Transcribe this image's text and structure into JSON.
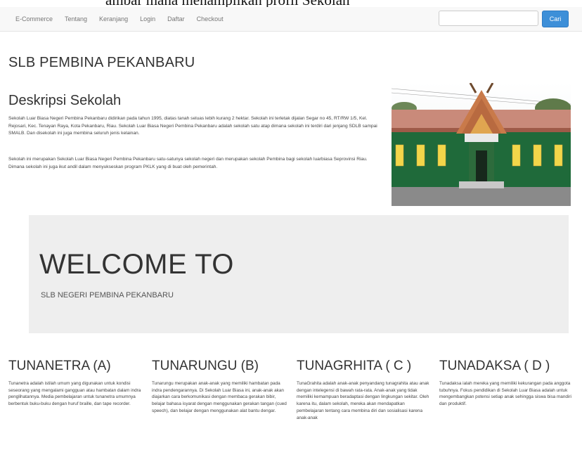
{
  "caption": "ambar mana menampilkan profil Sekolah",
  "navbar": {
    "links": [
      "E-Commerce",
      "Tentang",
      "Keranjang",
      "Login",
      "Daftar",
      "Checkout"
    ],
    "search": {
      "value": "",
      "placeholder": ""
    },
    "search_button": "Cari"
  },
  "school_name": "SLB PEMBINA PEKANBARU",
  "description": {
    "title": "Deskripsi Sekolah",
    "paragraph1": "Sekolah Luar Biasa Negeri Pembina Pekanbaru didirikan pada tahun 1995, diatas tanah seluas lebih kurang 2 hektar. Sekolah ini terletak dijalan Segar no 45, RT/RW 1/5, Kel. Rejosari, Kec. Tenayan Raya, Kota Pekanbaru, Riau. Sekolah Luar Biasa Negeri Pembina Pekanbaru adalah sekolah satu atap dimana sekolah ini terdiri dari jenjang SDLB sampai SMALB. Dan disekolah ini juga membina seluruh jenis kelainan.",
    "paragraph2": "Sekolah ini merupakan Sekolah Luar Biasa Negeri Pembina Pekanbaru satu-satunya sekolah negeri dan merupakan sekolah Pembina bagi sekolah luarbiasa Seprovinsi Riau. Dimana sekolah ini juga ikut andil dalam menyukseskan program PKLK yang di buat oleh pemerintah."
  },
  "jumbotron": {
    "heading": "WELCOME TO",
    "subheading": "SLB NEGERI PEMBINA PEKANBARU"
  },
  "categories": [
    {
      "title": "TUNANETRA (A)",
      "text": "Tunanetra adalah istilah umum yang digunakan untuk kondisi seseorang yang mengalami gangguan atau hambatan dalam indra penglihatannya. Media pembelajaran untuk tunanetra umumnya berbentuk buku-buku dengan huruf braille, dan tape recorder."
    },
    {
      "title": "TUNARUNGU (B)",
      "text": "Tunarungu merupakan anak-anak yang memiliki hambatan pada indra pendengarannya. Di Sekolah Luar Biasa ini, anak-anak akan diajarkan cara berkomunikasi dengan membaca gerakan bibir, belajar bahasa isyarat dengan menggunakan gerakan tangan (cued speech), dan belajar dengan menggunakan alat bantu dengar."
    },
    {
      "title": "TUNAGRHITA ( C )",
      "text": "TunaGrahita adalah anak-anak penyandang tunagrahita atau anak dengan intelegensi di bawah rata-rata. Anak-anak yang tidak memiliki kemampuan beradaptasi dengan lingkungan sekitar. Oleh karena itu, dalam sekolah, mereka akan mendapatkan pembelajaran tentang cara membina diri dan sosialisasi karena anak-anak"
    },
    {
      "title": "TUNADAKSA ( D )",
      "text": "Tunadaksa ialah mereka yang memiliki kekurangan pada anggota tubuhnya. Fokus pendidikan di Sekolah Luar Biasa adalah untuk mengembangkan potensi setiap anak sehingga siswa bisa mandiri dan produktif."
    }
  ],
  "colors": {
    "accent": "#3d8fd8",
    "jumbotron_bg": "#eeeeee",
    "navbar_bg": "#f8f8f8"
  }
}
